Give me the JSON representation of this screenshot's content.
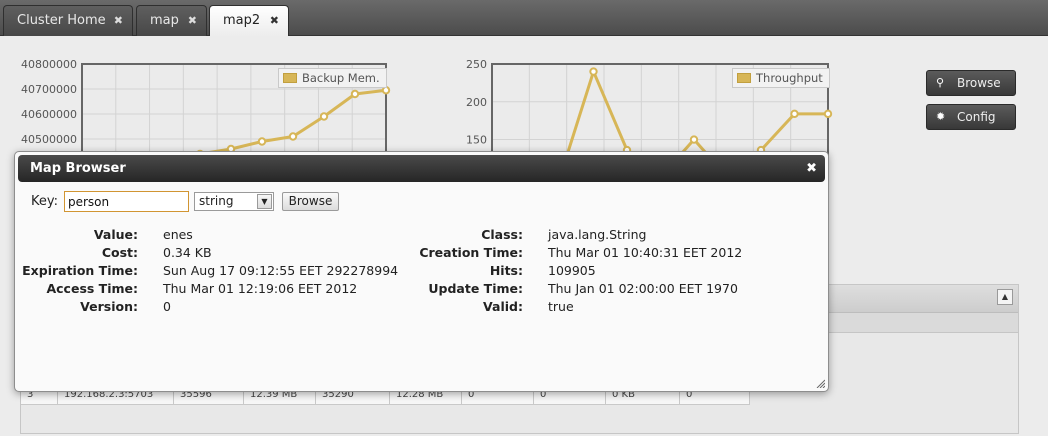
{
  "tabs": [
    {
      "label": "Cluster Home",
      "active": false
    },
    {
      "label": "map",
      "active": false
    },
    {
      "label": "map2",
      "active": true
    }
  ],
  "charts": [
    {
      "chart_data": {
        "type": "line",
        "series": [
          {
            "name": "Backup Mem.",
            "y": [
              40440000,
              40460000,
              40490000,
              40510000,
              40590000,
              40680000,
              40695000
            ]
          }
        ],
        "yticks": [
          "40800000",
          "40700000",
          "40600000",
          "40500000"
        ],
        "ylim": [
          40400000,
          40800000
        ],
        "color": "#d7b657"
      }
    },
    {
      "chart_data": {
        "type": "line",
        "series": [
          {
            "name": "Throughput",
            "y": [
              100,
              240,
              136,
              100,
              150,
              100,
              136,
              184,
              184
            ]
          }
        ],
        "yticks": [
          "250",
          "200",
          "150"
        ],
        "ylim": [
          100,
          250
        ],
        "color": "#d7b657"
      }
    }
  ],
  "side_buttons": {
    "browse_label": "Browse",
    "config_label": "Config"
  },
  "bg_table": {
    "row": [
      "3",
      "192.168.2.3:5703",
      "35596",
      "12.39 MB",
      "35290",
      "12.28 MB",
      "0",
      "0",
      "0 KB",
      "0"
    ]
  },
  "dialog": {
    "title": "Map Browser",
    "key_label": "Key:",
    "key_value": "person",
    "type_value": "string",
    "browse_label": "Browse",
    "left_fields": [
      {
        "label": "Value:",
        "value": "enes"
      },
      {
        "label": "Cost:",
        "value": "0.34 KB"
      },
      {
        "label": "Expiration Time:",
        "value": "Sun Aug 17 09:12:55 EET 292278994"
      },
      {
        "label": "Access Time:",
        "value": "Thu Mar 01 12:19:06 EET 2012"
      },
      {
        "label": "Version:",
        "value": "0"
      }
    ],
    "right_fields": [
      {
        "label": "Class:",
        "value": "java.lang.String"
      },
      {
        "label": "Creation Time:",
        "value": "Thu Mar 01 10:40:31 EET 2012"
      },
      {
        "label": "Hits:",
        "value": "109905"
      },
      {
        "label": "Update Time:",
        "value": "Thu Jan 01 02:00:00 EET 1970"
      },
      {
        "label": "Valid:",
        "value": "true"
      }
    ]
  }
}
